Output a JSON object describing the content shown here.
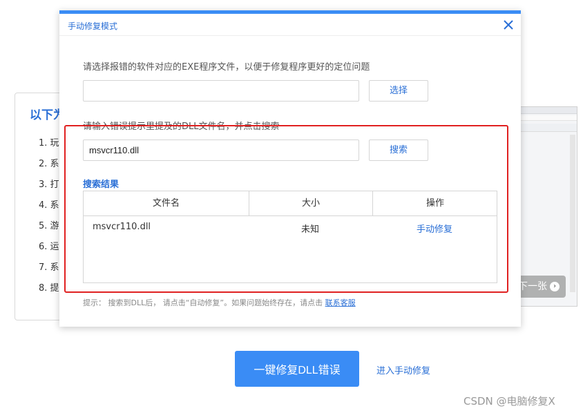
{
  "background": {
    "title": "以下为",
    "list": [
      "1. 玩",
      "2. 系",
      "3. 打",
      "4. 系",
      "5. 游",
      "6. 运",
      "7. 系",
      "8. 提"
    ],
    "next_label": "下一张",
    "repair_button": "一键修复DLL错误",
    "manual_link": "进入手动修复",
    "watermark": "CSDN @电脑修复X"
  },
  "dialog": {
    "title": "手动修复模式",
    "exe_instruction": "请选择报错的软件对应的EXE程序文件，以便于修复程序更好的定位问题",
    "exe_path_value": "",
    "select_button": "选择",
    "dll_instruction": "请输入错误提示里提及的DLL文件名，并点击搜索",
    "dll_name_value": "msvcr110.dll",
    "search_button": "搜索",
    "results_title": "搜索结果",
    "table": {
      "headers": [
        "文件名",
        "大小",
        "操作"
      ],
      "rows": [
        {
          "name": "msvcr110.dll",
          "size": "未知",
          "action": "手动修复"
        }
      ]
    },
    "hint_text": "提示： 搜索到DLL后， 请点击“自动修复”。如果问题始终存在，请点击",
    "hint_link": "联系客服"
  },
  "colors": {
    "accent": "#3a8cf5",
    "link": "#2a6fd6",
    "highlight": "#e02020"
  }
}
